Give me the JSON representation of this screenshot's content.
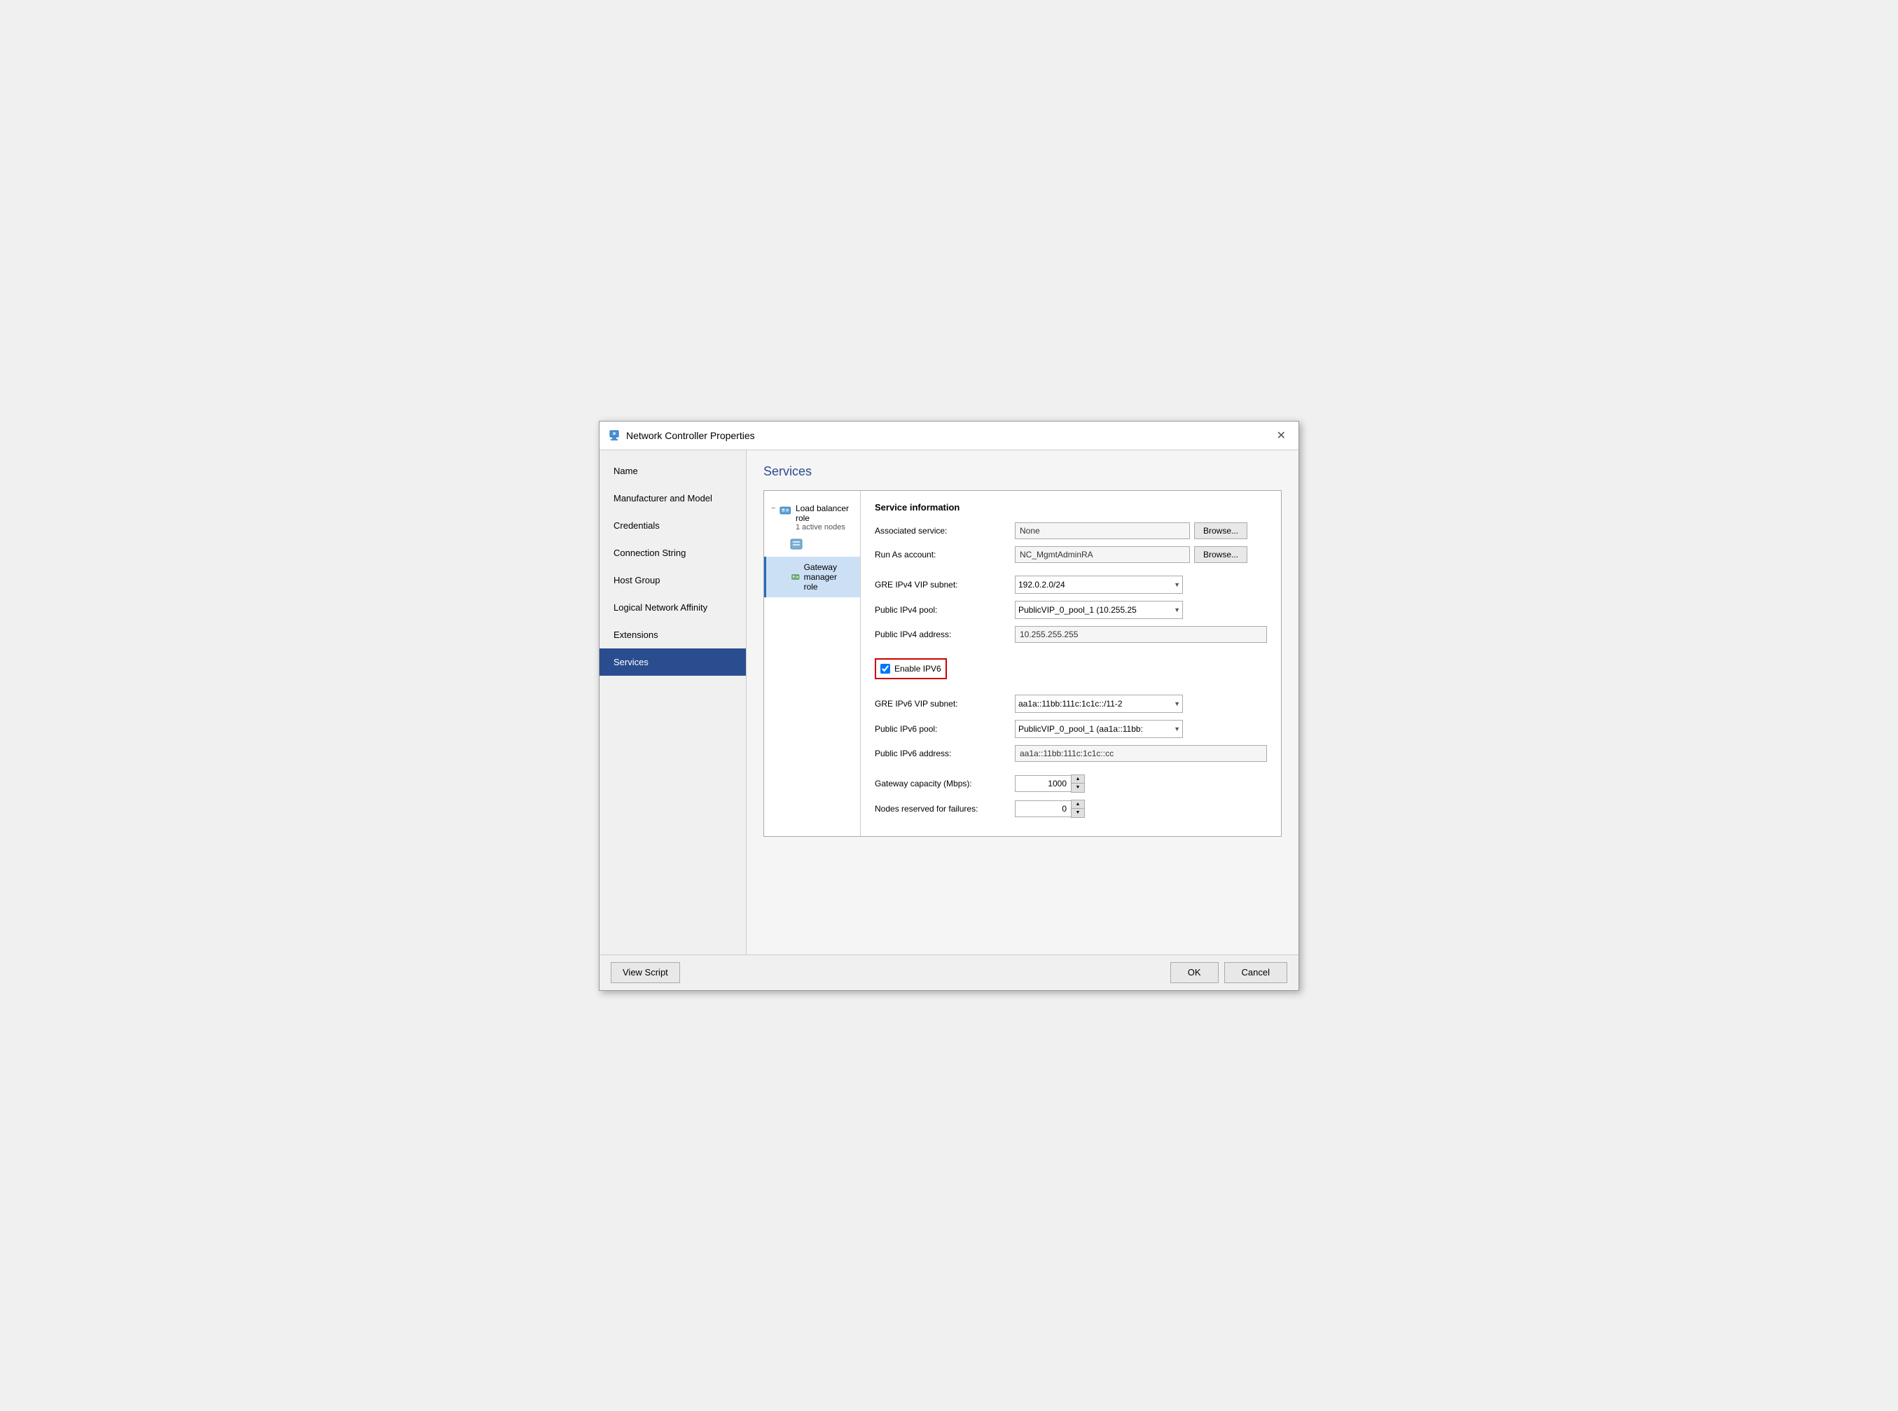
{
  "window": {
    "title": "Network Controller Properties",
    "close_label": "✕"
  },
  "sidebar": {
    "items": [
      {
        "id": "name",
        "label": "Name",
        "active": false
      },
      {
        "id": "manufacturer",
        "label": "Manufacturer and Model",
        "active": false
      },
      {
        "id": "credentials",
        "label": "Credentials",
        "active": false
      },
      {
        "id": "connection-string",
        "label": "Connection String",
        "active": false
      },
      {
        "id": "host-group",
        "label": "Host Group",
        "active": false
      },
      {
        "id": "logical-network",
        "label": "Logical Network Affinity",
        "active": false
      },
      {
        "id": "extensions",
        "label": "Extensions",
        "active": false
      },
      {
        "id": "services",
        "label": "Services",
        "active": true
      }
    ]
  },
  "main": {
    "section_title": "Services",
    "tree": {
      "load_balancer": {
        "label": "Load balancer role",
        "sub_label": "1 active nodes",
        "expand_icon": "−"
      },
      "gateway_manager": {
        "label": "Gateway manager role"
      }
    },
    "service_info": {
      "title": "Service information",
      "fields": {
        "associated_service_label": "Associated service:",
        "associated_service_value": "None",
        "run_as_label": "Run As account:",
        "run_as_value": "NC_MgmtAdminRA",
        "gre_ipv4_label": "GRE IPv4 VIP subnet:",
        "gre_ipv4_value": "192.0.2.0/24",
        "public_ipv4_pool_label": "Public IPv4 pool:",
        "public_ipv4_pool_value": "PublicVIP_0_pool_1 (10.255.25",
        "public_ipv4_addr_label": "Public IPv4 address:",
        "public_ipv4_addr_value": "10.255.255.255",
        "enable_ipv6_label": "Enable IPV6",
        "gre_ipv6_label": "GRE IPv6 VIP subnet:",
        "gre_ipv6_value": "aa1a::11bb:111c:1c1c::/11-2",
        "public_ipv6_pool_label": "Public IPv6 pool:",
        "public_ipv6_pool_value": "PublicVIP_0_pool_1 (aa1a::11bb:",
        "public_ipv6_addr_label": "Public IPv6 address:",
        "public_ipv6_addr_value": "aa1a::11bb:111c:1c1c::cc",
        "gateway_capacity_label": "Gateway capacity (Mbps):",
        "gateway_capacity_value": "1000",
        "nodes_reserved_label": "Nodes reserved for failures:",
        "nodes_reserved_value": "0"
      }
    }
  },
  "buttons": {
    "browse1": "Browse...",
    "browse2": "Browse...",
    "view_script": "View Script",
    "ok": "OK",
    "cancel": "Cancel"
  }
}
